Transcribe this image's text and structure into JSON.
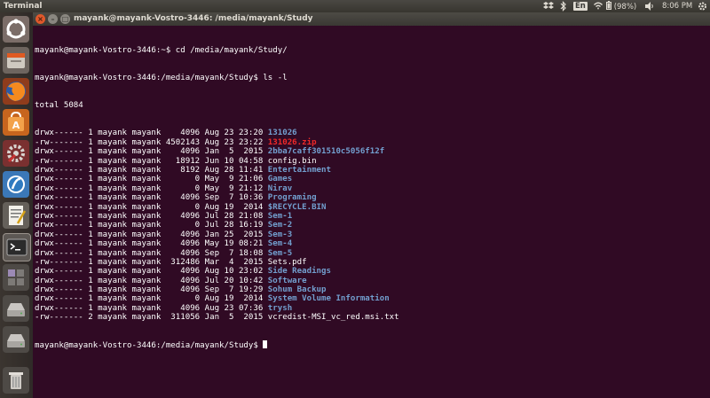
{
  "topbar": {
    "app_title": "Terminal",
    "keyboard_layout": "En",
    "battery_text": "(98%)",
    "clock": "8:06 PM"
  },
  "window": {
    "title": "mayank@mayank-Vostro-3446: /media/mayank/Study",
    "close_glyph": "×",
    "minimize_glyph": "–",
    "maximize_glyph": "□"
  },
  "launcher": {
    "items": [
      {
        "icon": "ubuntu-dash-icon"
      },
      {
        "icon": "file-manager-icon"
      },
      {
        "icon": "firefox-icon"
      },
      {
        "icon": "software-center-icon"
      },
      {
        "icon": "system-settings-icon"
      },
      {
        "icon": "software-updater-icon"
      },
      {
        "icon": "text-editor-icon"
      },
      {
        "icon": "terminal-icon"
      },
      {
        "icon": "workspace-switcher-icon"
      },
      {
        "icon": "drive-icon"
      },
      {
        "icon": "drive-icon"
      },
      {
        "icon": "trash-icon"
      }
    ]
  },
  "colors": {
    "terminal_bg": "#300a24",
    "text": "#ffffff",
    "directory": "#729fcf",
    "archive": "#ef2929",
    "panel": "#3c3b37"
  },
  "terminal": {
    "prompt1": "mayank@mayank-Vostro-3446:~$ cd /media/mayank/Study/",
    "prompt2": "mayank@mayank-Vostro-3446:/media/mayank/Study$ ls -l",
    "total": "total 5084",
    "final_prompt": "mayank@mayank-Vostro-3446:/media/mayank/Study$ ",
    "entries": [
      {
        "meta": "drwx------ 1 mayank mayank    4096 Aug 23 23:20 ",
        "name": "131026",
        "kind": "dir"
      },
      {
        "meta": "-rw------- 1 mayank mayank 4502143 Aug 23 23:22 ",
        "name": "131026.zip",
        "kind": "archive"
      },
      {
        "meta": "drwx------ 1 mayank mayank    4096 Jan  5  2015 ",
        "name": "2bba7caff301510c5056f12f",
        "kind": "dir"
      },
      {
        "meta": "-rw------- 1 mayank mayank   18912 Jun 10 04:58 ",
        "name": "config.bin",
        "kind": "file"
      },
      {
        "meta": "drwx------ 1 mayank mayank    8192 Aug 28 11:41 ",
        "name": "Entertainment",
        "kind": "dir"
      },
      {
        "meta": "drwx------ 1 mayank mayank       0 May  9 21:06 ",
        "name": "Games",
        "kind": "dir"
      },
      {
        "meta": "drwx------ 1 mayank mayank       0 May  9 21:12 ",
        "name": "Nirav",
        "kind": "dir"
      },
      {
        "meta": "drwx------ 1 mayank mayank    4096 Sep  7 10:36 ",
        "name": "Programing",
        "kind": "dir"
      },
      {
        "meta": "drwx------ 1 mayank mayank       0 Aug 19  2014 ",
        "name": "$RECYCLE.BIN",
        "kind": "dir"
      },
      {
        "meta": "drwx------ 1 mayank mayank    4096 Jul 28 21:08 ",
        "name": "Sem-1",
        "kind": "dir"
      },
      {
        "meta": "drwx------ 1 mayank mayank       0 Jul 28 16:19 ",
        "name": "Sem-2",
        "kind": "dir"
      },
      {
        "meta": "drwx------ 1 mayank mayank    4096 Jan 25  2015 ",
        "name": "Sem-3",
        "kind": "dir"
      },
      {
        "meta": "drwx------ 1 mayank mayank    4096 May 19 08:21 ",
        "name": "Sem-4",
        "kind": "dir"
      },
      {
        "meta": "drwx------ 1 mayank mayank    4096 Sep  7 18:08 ",
        "name": "Sem-5",
        "kind": "dir"
      },
      {
        "meta": "-rw------- 1 mayank mayank  312486 Mar  4  2015 ",
        "name": "Sets.pdf",
        "kind": "file"
      },
      {
        "meta": "drwx------ 1 mayank mayank    4096 Aug 10 23:02 ",
        "name": "Side Readings",
        "kind": "dir"
      },
      {
        "meta": "drwx------ 1 mayank mayank    4096 Jul 20 10:42 ",
        "name": "Software",
        "kind": "dir"
      },
      {
        "meta": "drwx------ 1 mayank mayank    4096 Sep  7 19:29 ",
        "name": "Sohum Backup",
        "kind": "dir"
      },
      {
        "meta": "drwx------ 1 mayank mayank       0 Aug 19  2014 ",
        "name": "System Volume Information",
        "kind": "dir"
      },
      {
        "meta": "drwx------ 1 mayank mayank    4096 Aug 23 07:36 ",
        "name": "trysh",
        "kind": "dir"
      },
      {
        "meta": "-rw------- 2 mayank mayank  311056 Jan  5  2015 ",
        "name": "vcredist-MSI_vc_red.msi.txt",
        "kind": "file"
      }
    ]
  }
}
